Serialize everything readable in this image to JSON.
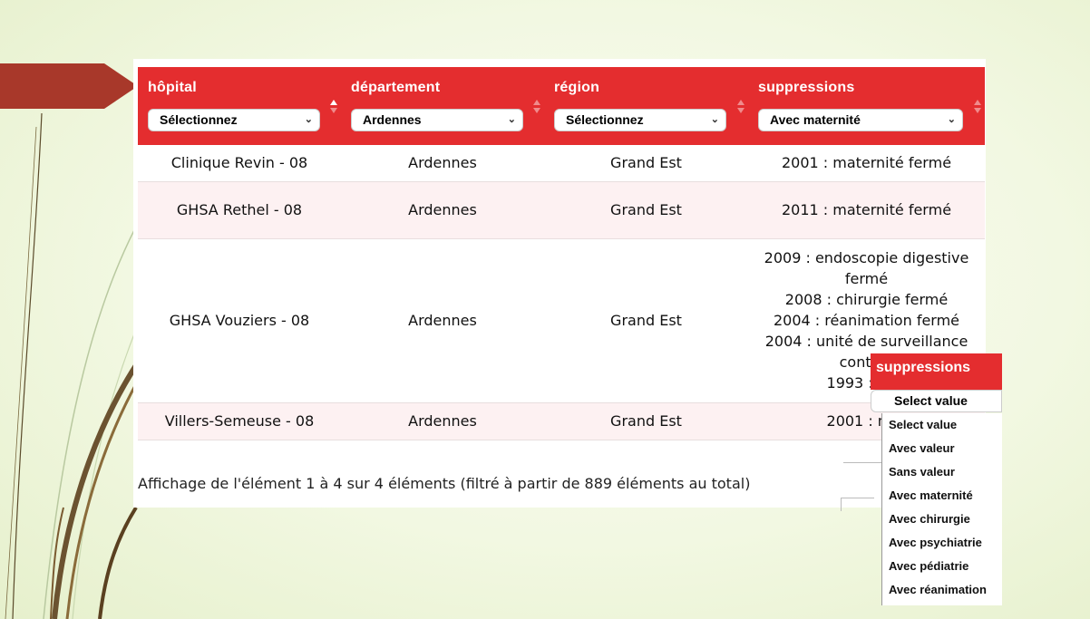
{
  "table": {
    "columns": [
      {
        "label": "hôpital",
        "filter": "Sélectionnez",
        "sorted": true
      },
      {
        "label": "département",
        "filter": "Ardennes",
        "sorted": false
      },
      {
        "label": "région",
        "filter": "Sélectionnez",
        "sorted": false
      },
      {
        "label": "suppressions",
        "filter": "Avec maternité",
        "sorted": false
      }
    ],
    "rows": [
      {
        "hopital": "Clinique Revin - 08",
        "departement": "Ardennes",
        "region": "Grand Est",
        "suppressions": [
          "2001 : maternité fermé"
        ]
      },
      {
        "hopital": "GHSA Rethel - 08",
        "departement": "Ardennes",
        "region": "Grand Est",
        "suppressions": [
          "2011 : maternité fermé"
        ]
      },
      {
        "hopital": "GHSA Vouziers - 08",
        "departement": "Ardennes",
        "region": "Grand Est",
        "suppressions": [
          "2009 : endoscopie digestive",
          "fermé",
          "2008 : chirurgie fermé",
          "2004 : réanimation fermé",
          "2004 : unité de surveillance",
          "continu",
          "1993 : mat"
        ]
      },
      {
        "hopital": "Villers-Semeuse - 08",
        "departement": "Ardennes",
        "region": "Grand Est",
        "suppressions": [
          "2001 : mat"
        ]
      }
    ]
  },
  "info_text": "Affichage de l'élément 1 à 4 sur 4 éléments (filtré à partir de 889 éléments au total)",
  "callout": {
    "title": "suppressions",
    "selected": "Select value",
    "options": [
      "Select value",
      "Avec valeur",
      "Sans valeur",
      "Avec maternité",
      "Avec chirurgie",
      "Avec psychiatrie",
      "Avec pédiatrie",
      "Avec réanimation"
    ]
  },
  "colors": {
    "header_red": "#e42d2f",
    "arrow_red": "#a8382a",
    "row_tint": "#fdf1f2"
  }
}
